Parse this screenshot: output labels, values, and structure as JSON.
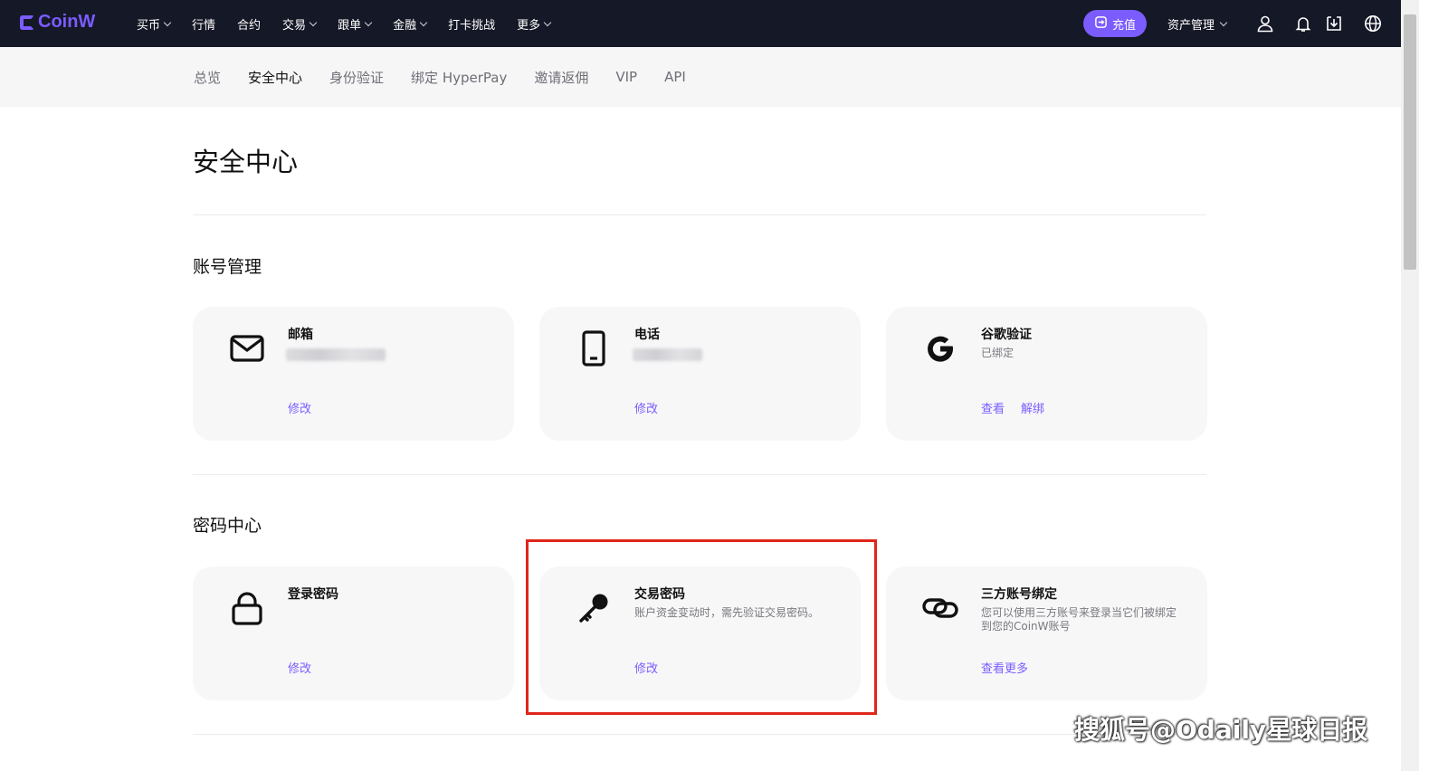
{
  "brand": {
    "name": "CoinW",
    "color": "#7b5cff"
  },
  "top_nav": {
    "items": [
      {
        "label": "买币",
        "dropdown": true
      },
      {
        "label": "行情",
        "dropdown": false
      },
      {
        "label": "合约",
        "dropdown": false
      },
      {
        "label": "交易",
        "dropdown": true
      },
      {
        "label": "跟单",
        "dropdown": true
      },
      {
        "label": "金融",
        "dropdown": true
      },
      {
        "label": "打卡挑战",
        "dropdown": false
      },
      {
        "label": "更多",
        "dropdown": true
      }
    ],
    "deposit_label": "充值",
    "asset_management_label": "资产管理",
    "icons": [
      "user-icon",
      "bell-icon",
      "download-icon",
      "globe-icon"
    ]
  },
  "sub_nav": {
    "items": [
      "总览",
      "安全中心",
      "身份验证",
      "绑定 HyperPay",
      "邀请返佣",
      "VIP",
      "API"
    ],
    "active": "安全中心"
  },
  "page": {
    "title": "安全中心"
  },
  "sections": [
    {
      "title": "账号管理",
      "cards": [
        {
          "icon": "mail-icon",
          "title": "邮箱",
          "desc": "",
          "masked": true,
          "actions": [
            "修改"
          ]
        },
        {
          "icon": "phone-icon",
          "title": "电话",
          "desc": "",
          "masked": true,
          "actions": [
            "修改"
          ]
        },
        {
          "icon": "google-icon",
          "title": "谷歌验证",
          "desc": "已绑定",
          "masked": false,
          "actions": [
            "查看",
            "解绑"
          ]
        }
      ]
    },
    {
      "title": "密码中心",
      "cards": [
        {
          "icon": "lock-icon",
          "title": "登录密码",
          "desc": "",
          "masked": false,
          "actions": [
            "修改"
          ]
        },
        {
          "icon": "key-icon",
          "title": "交易密码",
          "desc": "账户资金变动时，需先验证交易密码。",
          "masked": false,
          "actions": [
            "修改"
          ],
          "highlighted": true
        },
        {
          "icon": "link-icon",
          "title": "三方账号绑定",
          "desc": "您可以使用三方账号来登录当它们被绑定到您的CoinW账号",
          "masked": false,
          "actions": [
            "查看更多"
          ]
        }
      ]
    }
  ],
  "watermark": "搜狐号@Odaily星球日报",
  "colors": {
    "accent": "#7b5cff",
    "topbar": "#151826",
    "highlight": "#e0261c"
  }
}
